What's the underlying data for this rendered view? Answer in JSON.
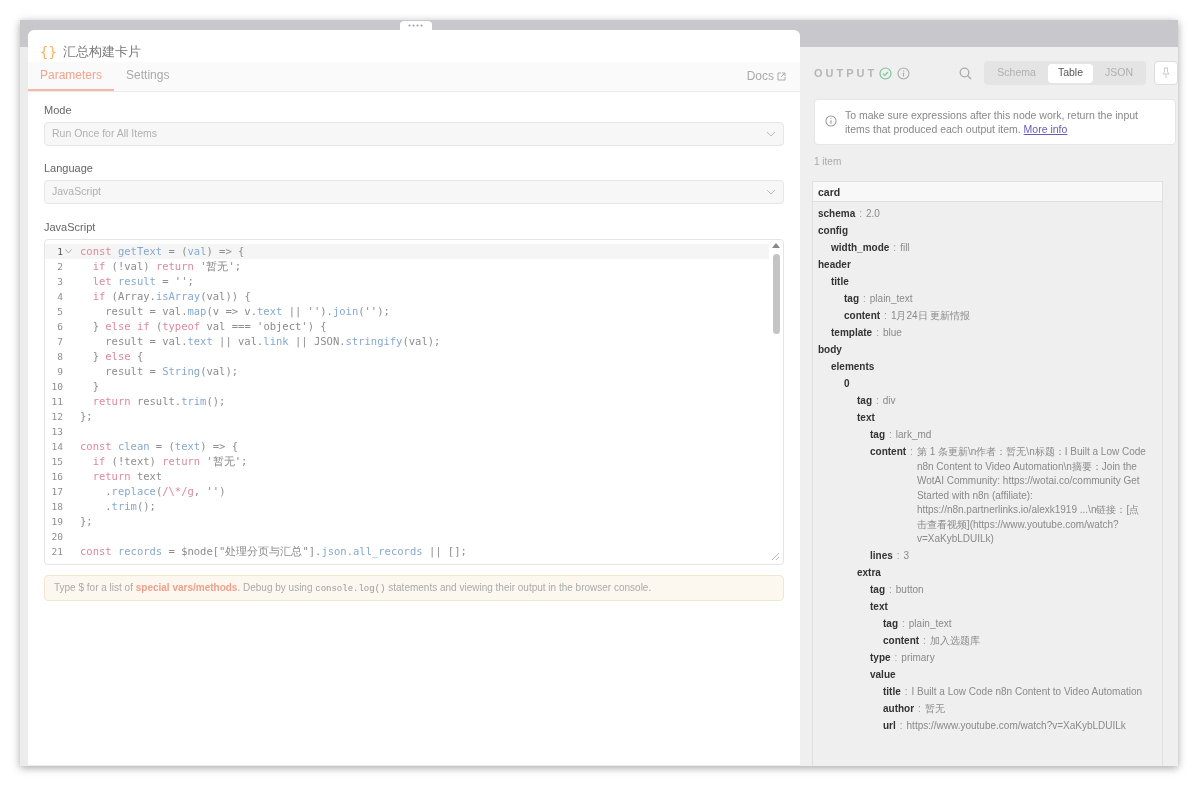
{
  "node": {
    "icon": "{}",
    "title": "汇总构建卡片"
  },
  "tabs": [
    {
      "label": "Parameters",
      "selected": true
    },
    {
      "label": "Settings",
      "selected": false
    }
  ],
  "docs_link": "Docs",
  "fields": [
    {
      "label": "Mode",
      "value": "Run Once for All Items"
    },
    {
      "label": "Language",
      "value": "JavaScript"
    }
  ],
  "editor": {
    "label": "JavaScript",
    "lines": [
      {
        "number": "1",
        "fold": true,
        "active": true,
        "tokens": [
          {
            "kind": "kw",
            "text": "const"
          },
          {
            "kind": "d",
            "text": " getText"
          },
          {
            "kind": "p",
            "text": " = ("
          },
          {
            "kind": "d",
            "text": "val"
          },
          {
            "kind": "p",
            "text": ") => {"
          }
        ]
      },
      {
        "number": "2",
        "fold": false,
        "active": false,
        "tokens": [
          {
            "kind": "kw",
            "text": "  if"
          },
          {
            "kind": "p",
            "text": " (!val) "
          },
          {
            "kind": "kw",
            "text": "return"
          },
          {
            "kind": "s",
            "text": " '暂无'"
          },
          {
            "kind": "p",
            "text": ";"
          }
        ]
      },
      {
        "number": "3",
        "fold": false,
        "active": false,
        "tokens": [
          {
            "kind": "kw",
            "text": "  let"
          },
          {
            "kind": "d",
            "text": " result"
          },
          {
            "kind": "p",
            "text": " = "
          },
          {
            "kind": "s",
            "text": "''"
          },
          {
            "kind": "p",
            "text": ";"
          }
        ]
      },
      {
        "number": "4",
        "fold": false,
        "active": false,
        "tokens": [
          {
            "kind": "kw",
            "text": "  if"
          },
          {
            "kind": "p",
            "text": " (Array."
          },
          {
            "kind": "d",
            "text": "isArray"
          },
          {
            "kind": "p",
            "text": "(val)) {"
          }
        ]
      },
      {
        "number": "5",
        "fold": false,
        "active": false,
        "tokens": [
          {
            "kind": "p",
            "text": "    result = val."
          },
          {
            "kind": "d",
            "text": "map"
          },
          {
            "kind": "p",
            "text": "(v => v."
          },
          {
            "kind": "d",
            "text": "text"
          },
          {
            "kind": "p",
            "text": " || "
          },
          {
            "kind": "s",
            "text": "''"
          },
          {
            "kind": "p",
            "text": ")."
          },
          {
            "kind": "d",
            "text": "join"
          },
          {
            "kind": "p",
            "text": "("
          },
          {
            "kind": "s",
            "text": "''"
          },
          {
            "kind": "p",
            "text": ");"
          }
        ]
      },
      {
        "number": "6",
        "fold": false,
        "active": false,
        "tokens": [
          {
            "kind": "p",
            "text": "  } "
          },
          {
            "kind": "kw",
            "text": "else if"
          },
          {
            "kind": "p",
            "text": " ("
          },
          {
            "kind": "kw",
            "text": "typeof"
          },
          {
            "kind": "p",
            "text": " val === "
          },
          {
            "kind": "s",
            "text": "'object'"
          },
          {
            "kind": "p",
            "text": ") {"
          }
        ]
      },
      {
        "number": "7",
        "fold": false,
        "active": false,
        "tokens": [
          {
            "kind": "p",
            "text": "    result = val."
          },
          {
            "kind": "d",
            "text": "text"
          },
          {
            "kind": "p",
            "text": " || val."
          },
          {
            "kind": "d",
            "text": "link"
          },
          {
            "kind": "p",
            "text": " || JSON."
          },
          {
            "kind": "d",
            "text": "stringify"
          },
          {
            "kind": "p",
            "text": "(val);"
          }
        ]
      },
      {
        "number": "8",
        "fold": false,
        "active": false,
        "tokens": [
          {
            "kind": "p",
            "text": "  } "
          },
          {
            "kind": "kw",
            "text": "else"
          },
          {
            "kind": "p",
            "text": " {"
          }
        ]
      },
      {
        "number": "9",
        "fold": false,
        "active": false,
        "tokens": [
          {
            "kind": "p",
            "text": "    result = "
          },
          {
            "kind": "d",
            "text": "String"
          },
          {
            "kind": "p",
            "text": "(val);"
          }
        ]
      },
      {
        "number": "10",
        "fold": false,
        "active": false,
        "tokens": [
          {
            "kind": "p",
            "text": "  }"
          }
        ]
      },
      {
        "number": "11",
        "fold": false,
        "active": false,
        "tokens": [
          {
            "kind": "kw",
            "text": "  return"
          },
          {
            "kind": "p",
            "text": " result."
          },
          {
            "kind": "d",
            "text": "trim"
          },
          {
            "kind": "p",
            "text": "();"
          }
        ]
      },
      {
        "number": "12",
        "fold": false,
        "active": false,
        "tokens": [
          {
            "kind": "p",
            "text": "};"
          }
        ]
      },
      {
        "number": "13",
        "fold": false,
        "active": false
      },
      {
        "number": "14",
        "fold": false,
        "active": false,
        "tokens": [
          {
            "kind": "kw",
            "text": "const"
          },
          {
            "kind": "d",
            "text": " clean"
          },
          {
            "kind": "p",
            "text": " = ("
          },
          {
            "kind": "d",
            "text": "text"
          },
          {
            "kind": "p",
            "text": ") => {"
          }
        ]
      },
      {
        "number": "15",
        "fold": false,
        "active": false,
        "tokens": [
          {
            "kind": "kw",
            "text": "  if"
          },
          {
            "kind": "p",
            "text": " (!text) "
          },
          {
            "kind": "kw",
            "text": "return"
          },
          {
            "kind": "s",
            "text": " '暂无'"
          },
          {
            "kind": "p",
            "text": ";"
          }
        ]
      },
      {
        "number": "16",
        "fold": false,
        "active": false,
        "tokens": [
          {
            "kind": "kw",
            "text": "  return"
          },
          {
            "kind": "p",
            "text": " text"
          }
        ]
      },
      {
        "number": "17",
        "fold": false,
        "active": false,
        "tokens": [
          {
            "kind": "p",
            "text": "    ."
          },
          {
            "kind": "d",
            "text": "replace"
          },
          {
            "kind": "p",
            "text": "("
          },
          {
            "kind": "kw",
            "text": "/\\*/g"
          },
          {
            "kind": "p",
            "text": ", "
          },
          {
            "kind": "s",
            "text": "''"
          },
          {
            "kind": "p",
            "text": ")"
          }
        ]
      },
      {
        "number": "18",
        "fold": false,
        "active": false,
        "tokens": [
          {
            "kind": "p",
            "text": "    ."
          },
          {
            "kind": "d",
            "text": "trim"
          },
          {
            "kind": "p",
            "text": "();"
          }
        ]
      },
      {
        "number": "19",
        "fold": false,
        "active": false,
        "tokens": [
          {
            "kind": "p",
            "text": "};"
          }
        ]
      },
      {
        "number": "20",
        "fold": false,
        "active": false
      },
      {
        "number": "21",
        "fold": false,
        "active": false,
        "tokens": [
          {
            "kind": "kw",
            "text": "const"
          },
          {
            "kind": "d",
            "text": " records"
          },
          {
            "kind": "p",
            "text": " = $node["
          },
          {
            "kind": "s",
            "text": "\"处理分页与汇总\""
          },
          {
            "kind": "p",
            "text": "]."
          },
          {
            "kind": "d",
            "text": "json.all_records"
          },
          {
            "kind": "p",
            "text": " || [];"
          }
        ]
      }
    ]
  },
  "hint": {
    "before": "Type $ for a list of ",
    "link": "special vars/methods",
    "middle": ". Debug by using ",
    "code": "console.log()",
    "after": " statements and viewing their output in the browser console."
  },
  "output": {
    "title": "OUTPUT",
    "views": [
      {
        "label": "Schema",
        "selected": false
      },
      {
        "label": "Table",
        "selected": true
      },
      {
        "label": "JSON",
        "selected": false
      }
    ],
    "notice": {
      "text": "To make sure expressions after this node work, return the input items that produced each output item.",
      "link": "More info"
    },
    "count": "1 item",
    "root": "card",
    "tree": [
      {
        "key": "schema",
        "sep": ":",
        "value": "2.0"
      },
      {
        "key": "config",
        "children": [
          {
            "key": "width_mode",
            "sep": ":",
            "value": "fill"
          }
        ]
      },
      {
        "key": "header",
        "children": [
          {
            "key": "title",
            "children": [
              {
                "key": "tag",
                "sep": ":",
                "value": "plain_text"
              },
              {
                "key": "content",
                "sep": ":",
                "value": "1月24日 更新情报"
              }
            ]
          },
          {
            "key": "template",
            "sep": ":",
            "value": "blue"
          }
        ]
      },
      {
        "key": "body",
        "children": [
          {
            "key": "elements",
            "children": [
              {
                "key": "0",
                "children": [
                  {
                    "key": "tag",
                    "sep": ":",
                    "value": "div"
                  },
                  {
                    "key": "text",
                    "children": [
                      {
                        "key": "tag",
                        "sep": ":",
                        "value": "lark_md"
                      },
                      {
                        "key": "content",
                        "sep": ":",
                        "value": "第 1 条更新\\n作者：暂无\\n标题：I Built a Low Code n8n Content to Video Automation\\n摘要：Join the WotAI Community: https://wotai.co/community Get Started with n8n (affiliate): https://n8n.partnerlinks.io/alexk1919 ...\\n链接：[点击查看视频](https://www.youtube.com/watch?v=XaKybLDUILk)"
                      },
                      {
                        "key": "lines",
                        "sep": ":",
                        "value": "3"
                      }
                    ]
                  },
                  {
                    "key": "extra",
                    "children": [
                      {
                        "key": "tag",
                        "sep": ":",
                        "value": "button"
                      },
                      {
                        "key": "text",
                        "children": [
                          {
                            "key": "tag",
                            "sep": ":",
                            "value": "plain_text"
                          },
                          {
                            "key": "content",
                            "sep": ":",
                            "value": "加入选题库"
                          }
                        ]
                      },
                      {
                        "key": "type",
                        "sep": ":",
                        "value": "primary"
                      },
                      {
                        "key": "value",
                        "children": [
                          {
                            "key": "title",
                            "sep": ":",
                            "value": "I Built a Low Code n8n Content to Video Automation"
                          },
                          {
                            "key": "author",
                            "sep": ":",
                            "value": "暂无"
                          },
                          {
                            "key": "url",
                            "sep": ":",
                            "value": "https://www.youtube.com/watch?v=XaKybLDUILk"
                          }
                        ]
                      }
                    ]
                  }
                ]
              }
            ]
          }
        ]
      }
    ]
  }
}
